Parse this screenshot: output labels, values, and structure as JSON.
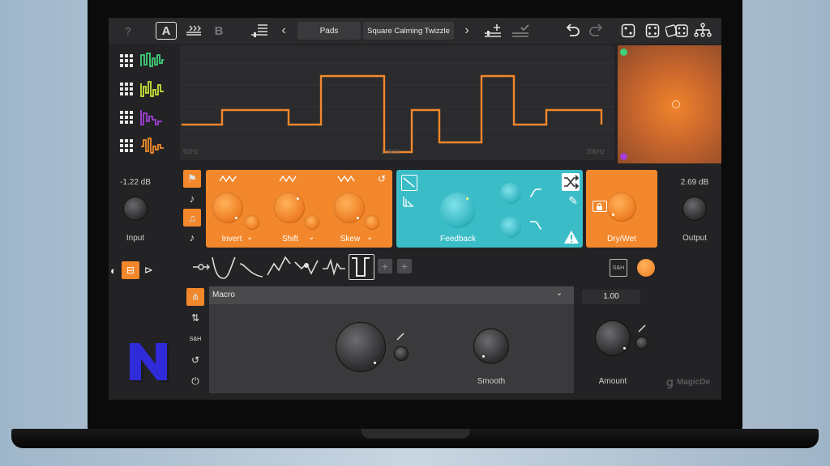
{
  "toolbar": {
    "help": "?",
    "preset_a": "A",
    "preset_b": "B",
    "category": "Pads",
    "preset_name": "Square Calming Twizzle",
    "prev": "‹",
    "next": "›"
  },
  "graph": {
    "freq_low": "50Hz",
    "freq_mid": "1.0kHz",
    "freq_high": "20kHz"
  },
  "lfo_colors": [
    "#3fd07a",
    "#c6e13a",
    "#a33fd8",
    "#f08a2b"
  ],
  "input": {
    "value": "-1.22 dB",
    "label": "Input"
  },
  "output": {
    "value": "2.69 dB",
    "label": "Output"
  },
  "orange_module": {
    "invert": "Invert",
    "shift": "Shift",
    "skew": "Skew"
  },
  "teal_module": {
    "feedback": "Feedback"
  },
  "drywet": {
    "label": "Dry/Wet"
  },
  "macro": {
    "selector": "Macro",
    "smooth_label": "Smooth",
    "amount_value": "1.00",
    "amount_label": "Amount",
    "sh_label": "S&H"
  },
  "shapes": {
    "sh_button": "S&H"
  },
  "brand": {
    "watermark": "MagicDe"
  },
  "colors": {
    "accent": "#f2872b",
    "teal": "#3bbdc7",
    "background": "#232325"
  }
}
